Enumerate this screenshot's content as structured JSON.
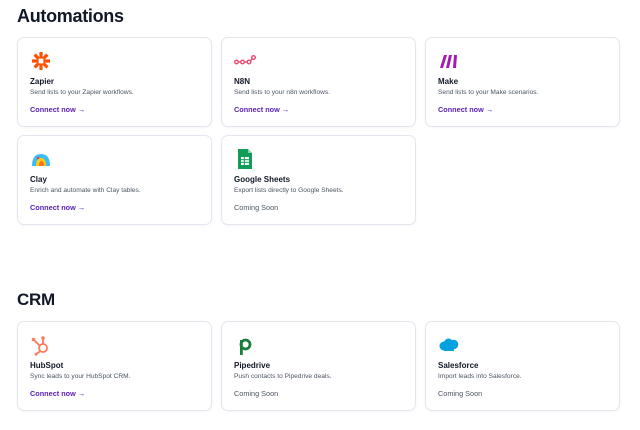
{
  "sections": {
    "automations": {
      "title": "Automations",
      "cards": [
        {
          "name": "Zapier",
          "desc": "Send lists to your Zapier workflows.",
          "action": "Connect now →",
          "icon": "zapier-icon"
        },
        {
          "name": "N8N",
          "desc": "Send lists to your n8n workflows.",
          "action": "Connect now →",
          "icon": "n8n-icon"
        },
        {
          "name": "Make",
          "desc": "Send lists to your Make scenarios.",
          "action": "Connect now →",
          "icon": "make-icon"
        },
        {
          "name": "Clay",
          "desc": "Enrich and automate with Clay tables.",
          "action": "Connect now →",
          "icon": "clay-icon"
        },
        {
          "name": "Google Sheets",
          "desc": "Export lists directly to Google Sheets.",
          "action": "Coming Soon",
          "icon": "google-sheets-icon"
        }
      ]
    },
    "crm": {
      "title": "CRM",
      "cards": [
        {
          "name": "HubSpot",
          "desc": "Sync leads to your HubSpot CRM.",
          "action": "Connect now →",
          "icon": "hubspot-icon"
        },
        {
          "name": "Pipedrive",
          "desc": "Push contacts to Pipedrive deals.",
          "action": "Coming Soon",
          "icon": "pipedrive-icon"
        },
        {
          "name": "Salesforce",
          "desc": "Import leads into Salesforce.",
          "action": "Coming Soon",
          "icon": "salesforce-icon"
        }
      ]
    }
  },
  "colors": {
    "link": "#5b21b6",
    "zapier": "#ff4f00",
    "n8n": "#ea4b71",
    "make": "#a21caf",
    "sheets": "#0f9d58",
    "hubspot": "#ff7a59",
    "pipedrive": "#1a7f3c",
    "salesforce": "#00a1e0"
  }
}
